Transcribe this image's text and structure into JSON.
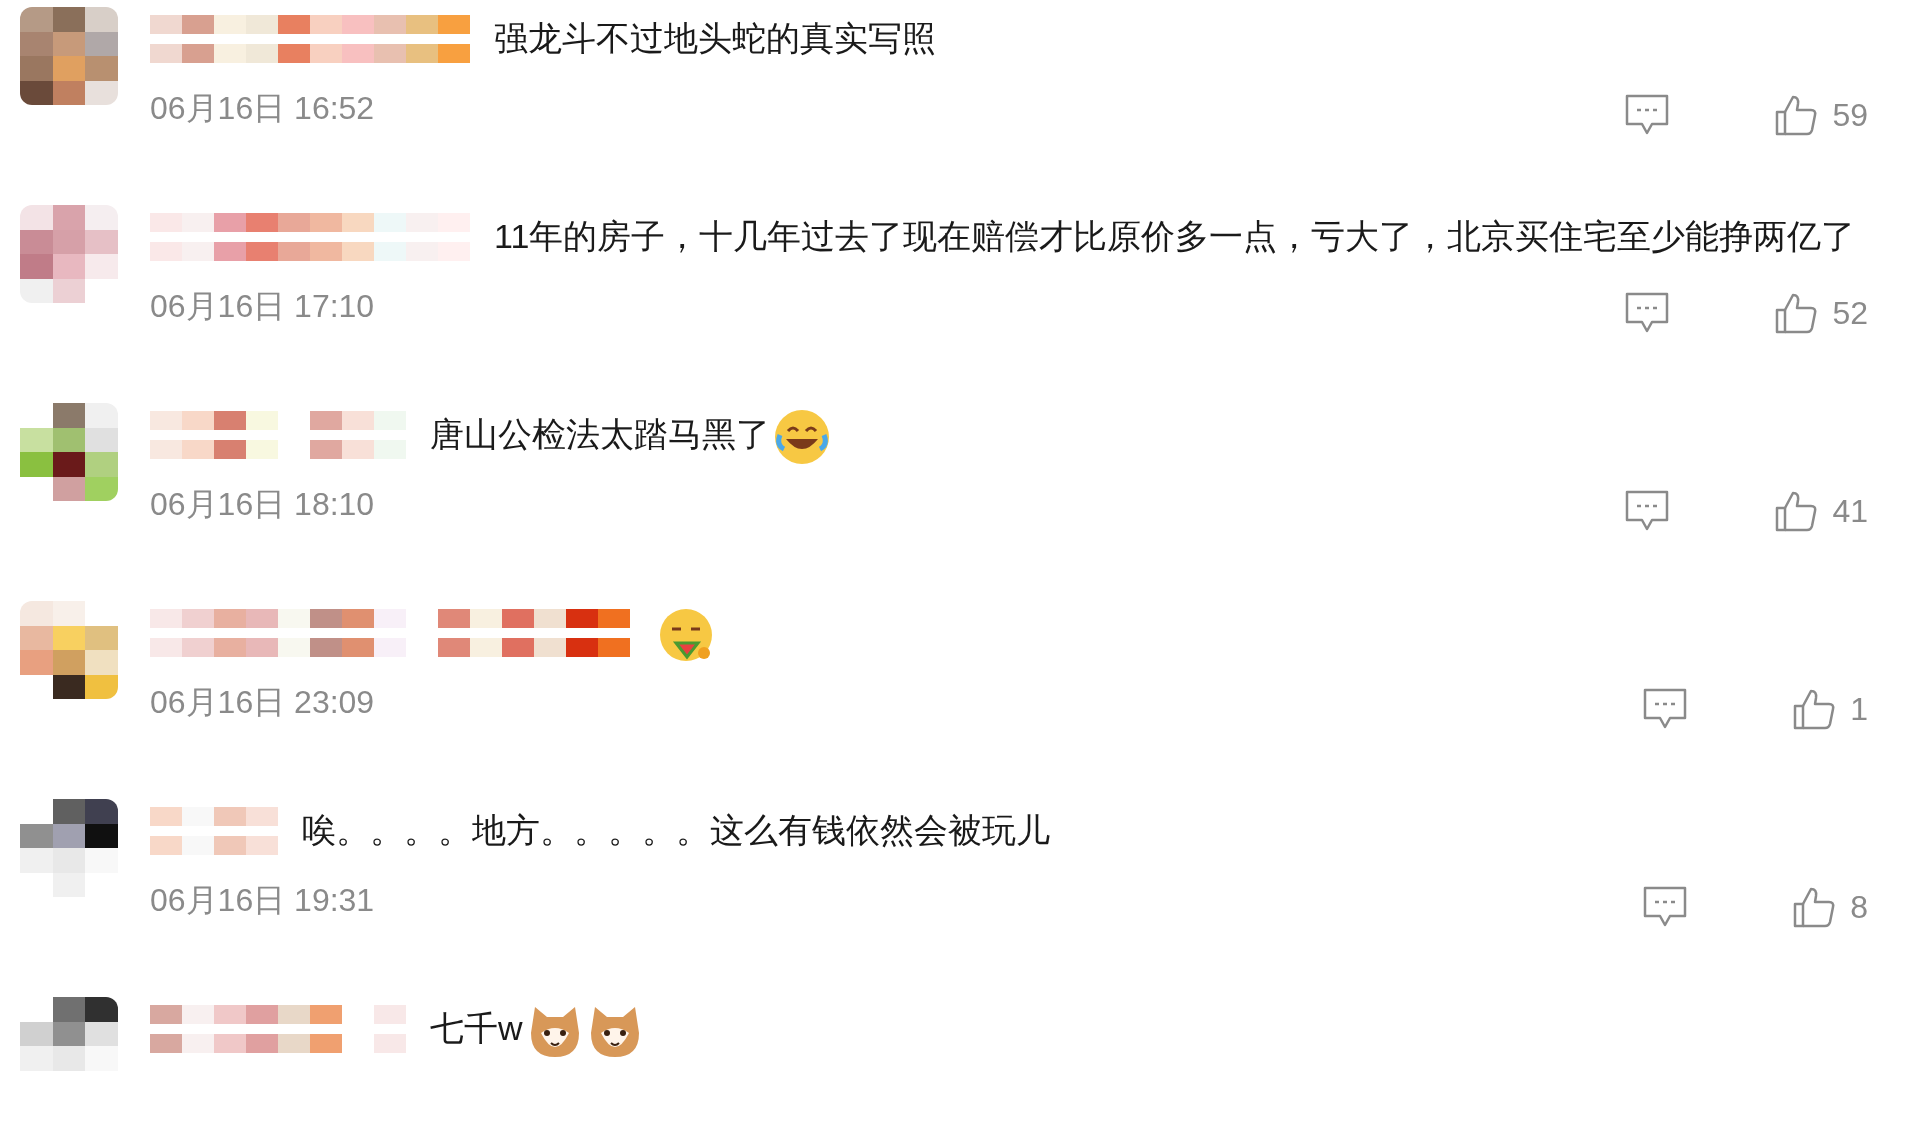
{
  "comments": [
    {
      "text": "强龙斗不过地头蛇的真实写照",
      "time": "06月16日 16:52",
      "likes": "59"
    },
    {
      "text": "11年的房子，十几年过去了现在赔偿才比原价多一点，亏大了，北京买住宅至少能挣两亿了",
      "time": "06月16日 17:10",
      "likes": "52"
    },
    {
      "text": "唐山公检法太踏马黑了",
      "emojis": [
        {
          "kind": "laugh"
        }
      ],
      "time": "06月16日 18:10",
      "likes": "41"
    },
    {
      "emojis": [
        {
          "kind": "watermelon"
        }
      ],
      "time": "06月16日 23:09",
      "likes": "1"
    },
    {
      "text": "唉。。。。地方。。。。。这么有钱依然会被玩儿",
      "time": "06月16日 19:31",
      "likes": "8"
    },
    {
      "text": "七千w",
      "emojis": [
        {
          "kind": "cat"
        },
        {
          "kind": "cat"
        }
      ]
    }
  ]
}
